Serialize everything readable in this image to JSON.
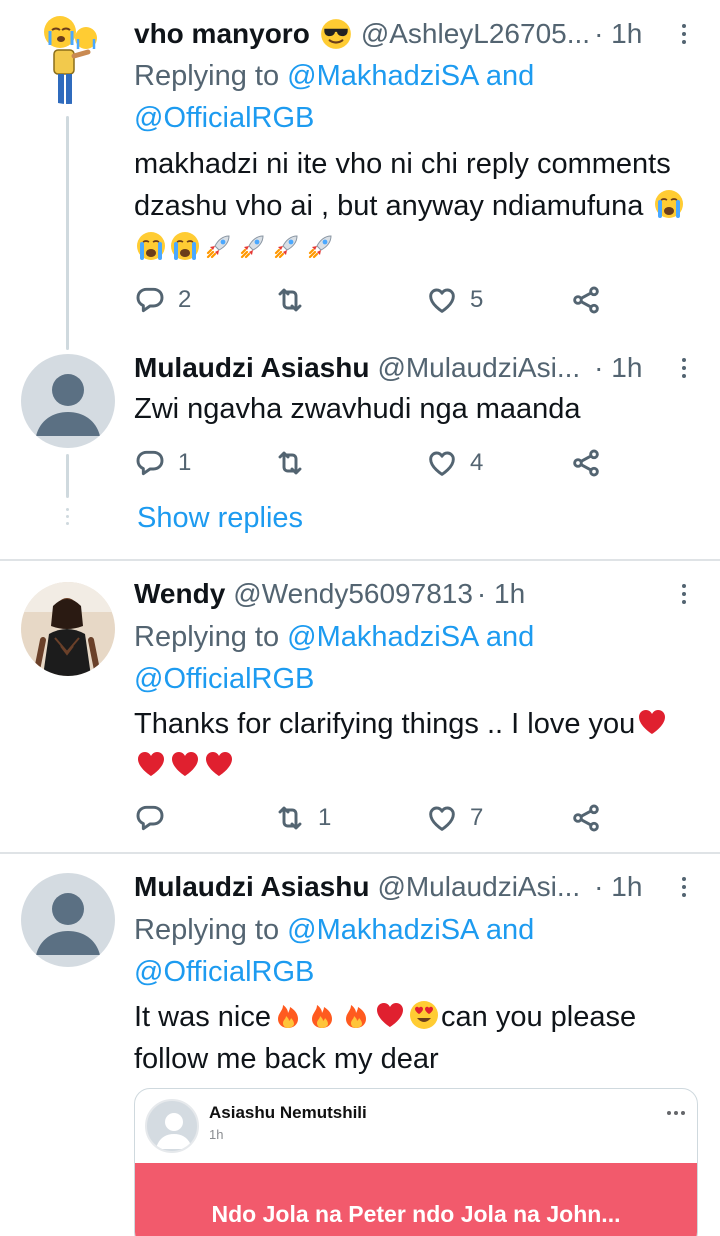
{
  "tweets": [
    {
      "name": "vho manyoro",
      "handle": "@AshleyL26705...",
      "time": "· 1h",
      "replying_prefix": "Replying to",
      "replying_mention1": "@MakhadziSA",
      "replying_and": "and",
      "replying_mention2": "@OfficialRGB",
      "text_line1": "makhadzi ni ite vho ni chi reply comments",
      "text_line2": "dzashu vho ai , but anyway ndiamufuna",
      "replies": "2",
      "retweets": "",
      "likes": "5"
    },
    {
      "name": "Mulaudzi Asiashu",
      "handle": "@MulaudziAsi...",
      "time": "· 1h",
      "text_line1": "Zwi ngavha zwavhudi nga maanda",
      "replies": "1",
      "retweets": "",
      "likes": "4",
      "show_replies": "Show replies"
    },
    {
      "name": "Wendy",
      "handle": "@Wendy56097813",
      "time": "· 1h",
      "replying_prefix": "Replying to",
      "replying_mention1": "@MakhadziSA",
      "replying_and": "and",
      "replying_mention2": "@OfficialRGB",
      "text_line1": "Thanks for clarifying things .. I love you",
      "replies": "",
      "retweets": "1",
      "likes": "7"
    },
    {
      "name": "Mulaudzi Asiashu",
      "handle": "@MulaudziAsi...",
      "time": "· 1h",
      "replying_prefix": "Replying to",
      "replying_mention1": "@MakhadziSA",
      "replying_and": "and",
      "replying_mention2": "@OfficialRGB",
      "text_line1_a": "It was nice",
      "text_line1_b": "can you please",
      "text_line2": "follow me back my dear",
      "quote": {
        "name": "Asiashu Nemutshili",
        "time": "1h",
        "banner_text": "Ndo Jola na Peter ndo Jola na John...",
        "banner_color": "#f25a6c"
      }
    }
  ],
  "colors": {
    "accent": "#1d9bf0",
    "secondary_text": "#536471",
    "primary_text": "#0f1419",
    "thread_line": "#cfd9de"
  },
  "icons": [
    "reply-icon",
    "retweet-icon",
    "like-icon",
    "share-icon",
    "more-icon"
  ]
}
